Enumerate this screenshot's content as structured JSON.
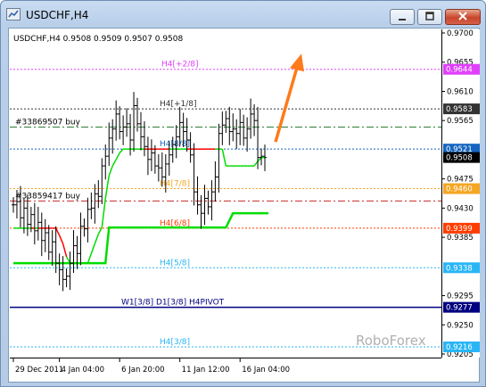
{
  "window": {
    "title": "USDCHF,H4"
  },
  "chart_info": "USDCHF,H4  0.9508 0.9509 0.9507 0.9508",
  "watermark": "RoboForex",
  "colors": {
    "bull_line": "#00dd00",
    "bear_line": "#ff0000",
    "arrow": "#ff7a1a",
    "pivot": "#000080"
  },
  "order_lines": [
    {
      "label": "#33869507 buy",
      "price": 0.9555,
      "color": "#2e7d32"
    },
    {
      "label": "#33859417 buy",
      "price": 0.9441,
      "color": "#c62828"
    }
  ],
  "murrey_lines": [
    {
      "label": "H4[+2/8]",
      "price": 0.9644,
      "color": "#e040fb"
    },
    {
      "label": "H4[+1/8]",
      "price": 0.9583,
      "color": "#333333"
    },
    {
      "label": "H4[8/8]",
      "price": 0.9521,
      "color": "#1565c0"
    },
    {
      "label": "H4[7/8]",
      "price": 0.946,
      "color": "#f5a623"
    },
    {
      "label": "H4[6/8]",
      "price": 0.9399,
      "color": "#ff3d00"
    },
    {
      "label": "H4[5/8]",
      "price": 0.9338,
      "color": "#29b6f6"
    },
    {
      "label": "W1[3/8] D1[3/8] H4PIVOT",
      "price": 0.9277,
      "color": "#000080"
    },
    {
      "label": "H4[3/8]",
      "price": 0.9216,
      "color": "#29b6f6"
    }
  ],
  "price_axis": {
    "ticks": [
      "0.9700",
      "0.9655",
      "0.9610",
      "0.9565",
      "0.9475",
      "0.9430",
      "0.9385",
      "0.9295",
      "0.9250",
      "0.9205"
    ],
    "badges": [
      {
        "label": "0.9644",
        "color": "#e040fb"
      },
      {
        "label": "0.9583",
        "color": "#333333"
      },
      {
        "label": "0.9521",
        "color": "#1565c0"
      },
      {
        "label": "0.9508",
        "color": "#000000"
      },
      {
        "label": "0.9460",
        "color": "#f5a623"
      },
      {
        "label": "0.9399",
        "color": "#ff3d00"
      },
      {
        "label": "0.9338",
        "color": "#29b6f6"
      },
      {
        "label": "0.9277",
        "color": "#000080"
      },
      {
        "label": "0.9216",
        "color": "#29b6f6"
      }
    ]
  },
  "time_axis": [
    "29 Dec 2011",
    "4 Jan 04:00",
    "6 Jan 20:00",
    "11 Jan 12:00",
    "16 Jan 04:00"
  ],
  "chart_data": {
    "type": "candlestick",
    "symbol": "USDCHF",
    "timeframe": "H4",
    "last": {
      "open": 0.9508,
      "high": 0.9509,
      "low": 0.9507,
      "close": 0.9508
    },
    "ylim": [
      0.9205,
      0.97
    ],
    "price_series": [
      0.9435,
      0.944,
      0.9415,
      0.943,
      0.9405,
      0.942,
      0.9395,
      0.9408,
      0.938,
      0.9392,
      0.9362,
      0.9378,
      0.9345,
      0.9335,
      0.932,
      0.9325,
      0.9345,
      0.9372,
      0.936,
      0.9402,
      0.9398,
      0.9428,
      0.943,
      0.9452,
      0.9448,
      0.9495,
      0.951,
      0.9538,
      0.9552,
      0.9575,
      0.9548,
      0.9555,
      0.956,
      0.9535,
      0.9588,
      0.956,
      0.954,
      0.9525,
      0.9505,
      0.9515,
      0.9495,
      0.9492,
      0.9478,
      0.9498,
      0.9512,
      0.9528,
      0.954,
      0.9562,
      0.9548,
      0.9535,
      0.9512,
      0.9455,
      0.9435,
      0.9422,
      0.9445,
      0.9432,
      0.9455,
      0.9478,
      0.9545,
      0.9558,
      0.9568,
      0.9548,
      0.9552,
      0.9545,
      0.9562,
      0.9538,
      0.9552,
      0.9575,
      0.9565,
      0.9508,
      0.951,
      0.9508
    ],
    "trend_line": [
      0.9399,
      0.9399,
      0.9399,
      0.9399,
      0.9399,
      0.9399,
      0.9399,
      0.9399,
      0.9399,
      0.9399,
      0.9399,
      0.9399,
      0.9399,
      0.9388,
      0.9375,
      0.9355,
      0.9345,
      0.9345,
      0.9345,
      0.9345,
      0.9345,
      0.9345,
      0.936,
      0.9375,
      0.939,
      0.94,
      0.9445,
      0.948,
      0.9495,
      0.9505,
      0.9515,
      0.9521,
      0.9521,
      0.9521,
      0.9521,
      0.9521,
      0.9521,
      0.9521,
      0.9521,
      0.9521,
      0.9521,
      0.9521,
      0.9521,
      0.9521,
      0.9521,
      0.9521,
      0.9521,
      0.9521,
      0.9521,
      0.9521,
      0.9521,
      0.9521,
      0.9521,
      0.9521,
      0.9521,
      0.9521,
      0.9521,
      0.9521,
      0.9521,
      0.9521,
      0.9495,
      0.9495,
      0.9495,
      0.9495,
      0.9495,
      0.9495,
      0.9495,
      0.9495,
      0.9495,
      0.9502,
      0.9508,
      0.9508
    ],
    "support_line": [
      [
        0,
        0.9345
      ],
      [
        26,
        0.9345
      ],
      [
        27,
        0.94
      ],
      [
        60,
        0.94
      ],
      [
        62,
        0.9422
      ],
      [
        72,
        0.9422
      ]
    ],
    "forecast_arrow": {
      "from": 0.9532,
      "to": 0.9668,
      "direction": "up"
    }
  }
}
